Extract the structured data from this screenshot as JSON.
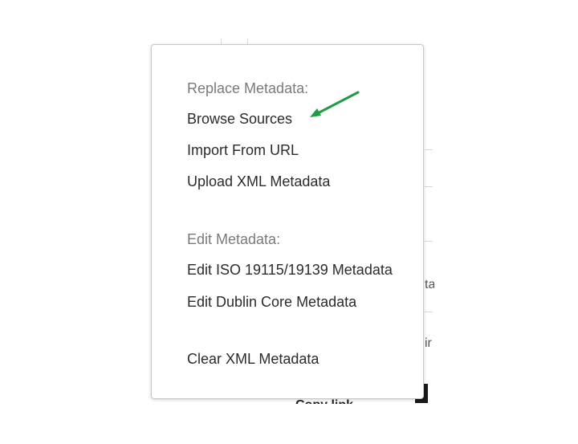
{
  "menu": {
    "replace_heading": "Replace Metadata:",
    "browse_sources": "Browse Sources",
    "import_from_url": "Import From URL",
    "upload_xml": "Upload XML Metadata",
    "edit_heading": "Edit Metadata:",
    "edit_iso": "Edit ISO 19115/19139 Metadata",
    "edit_dublin": "Edit Dublin Core Metadata",
    "clear_xml": "Clear XML Metadata"
  },
  "background": {
    "fragment_a": "ta",
    "fragment_b": "ir",
    "fragment_c": "Copy link"
  },
  "colors": {
    "heading": "#7a7a7a",
    "item": "#2b2b2b",
    "arrow": "#1f9a46"
  }
}
